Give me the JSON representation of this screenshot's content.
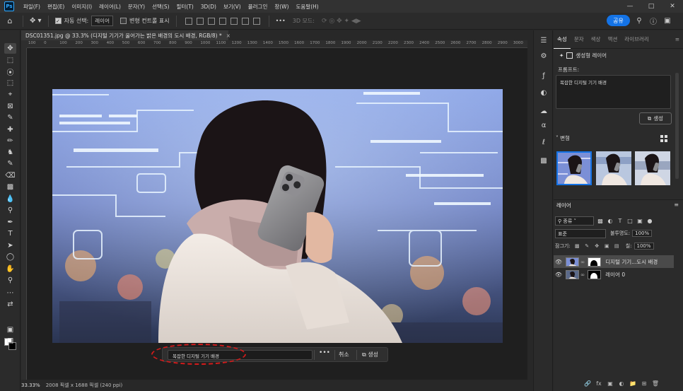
{
  "app": {
    "logo": "Ps"
  },
  "menu": [
    "파일(F)",
    "편집(E)",
    "이미지(I)",
    "레이어(L)",
    "문자(Y)",
    "선택(S)",
    "필터(T)",
    "3D(D)",
    "보기(V)",
    "플러그인",
    "창(W)",
    "도움말(H)"
  ],
  "options": {
    "auto_select_label": "자동 선택:",
    "auto_select_value": "레이어",
    "transform_label": "변형 컨트롤 표시",
    "mode_3d_label": "3D 모드:",
    "more": "•••"
  },
  "top_right": {
    "share_label": "공유"
  },
  "document": {
    "tab_title": "DSC01351.jpg @ 33.3% (디지털 기기가 울어가는 밝은 배경의 도시 배경, RGB/8) *",
    "close": "×",
    "ruler_ticks": [
      "100",
      "0",
      "100",
      "200",
      "300",
      "400",
      "500",
      "600",
      "700",
      "800",
      "900",
      "1000",
      "1100",
      "1200",
      "1300",
      "1400",
      "1500",
      "1600",
      "1700",
      "1800",
      "1900",
      "2000",
      "2100",
      "2200",
      "2300",
      "2400",
      "2500",
      "2600",
      "2700",
      "2800",
      "2900",
      "3000"
    ]
  },
  "taskbar": {
    "prompt_value": "복잡한 디지털 기기 배경",
    "more": "•••",
    "cancel_label": "취소",
    "generate_label": "생성"
  },
  "status": {
    "zoom": "33.33%",
    "info": "2008 픽셀 x 1688 픽셀 (240 ppi)"
  },
  "properties": {
    "tabs": [
      "속성",
      "문자",
      "색상",
      "액션",
      "라이브러리"
    ],
    "layer_type": "생성형 레이어",
    "prompt_label": "프롬프트:",
    "prompt_text": "복잡한 디지털 기기 배경",
    "generate_label": "생성",
    "variants_label": "변형"
  },
  "layers": {
    "tab_label": "레이어",
    "kind_label": "종류",
    "blend_mode": "표준",
    "opacity_label": "불투명도:",
    "opacity_value": "100%",
    "lock_label": "잠그기:",
    "fill_label": "칠:",
    "fill_value": "100%",
    "items": [
      {
        "name": "디지털 기기...도시 배경",
        "selected": true
      },
      {
        "name": "레이어 0",
        "selected": false
      }
    ]
  },
  "colors": {
    "accent": "#1473e6",
    "annotation": "#d11b1b"
  }
}
